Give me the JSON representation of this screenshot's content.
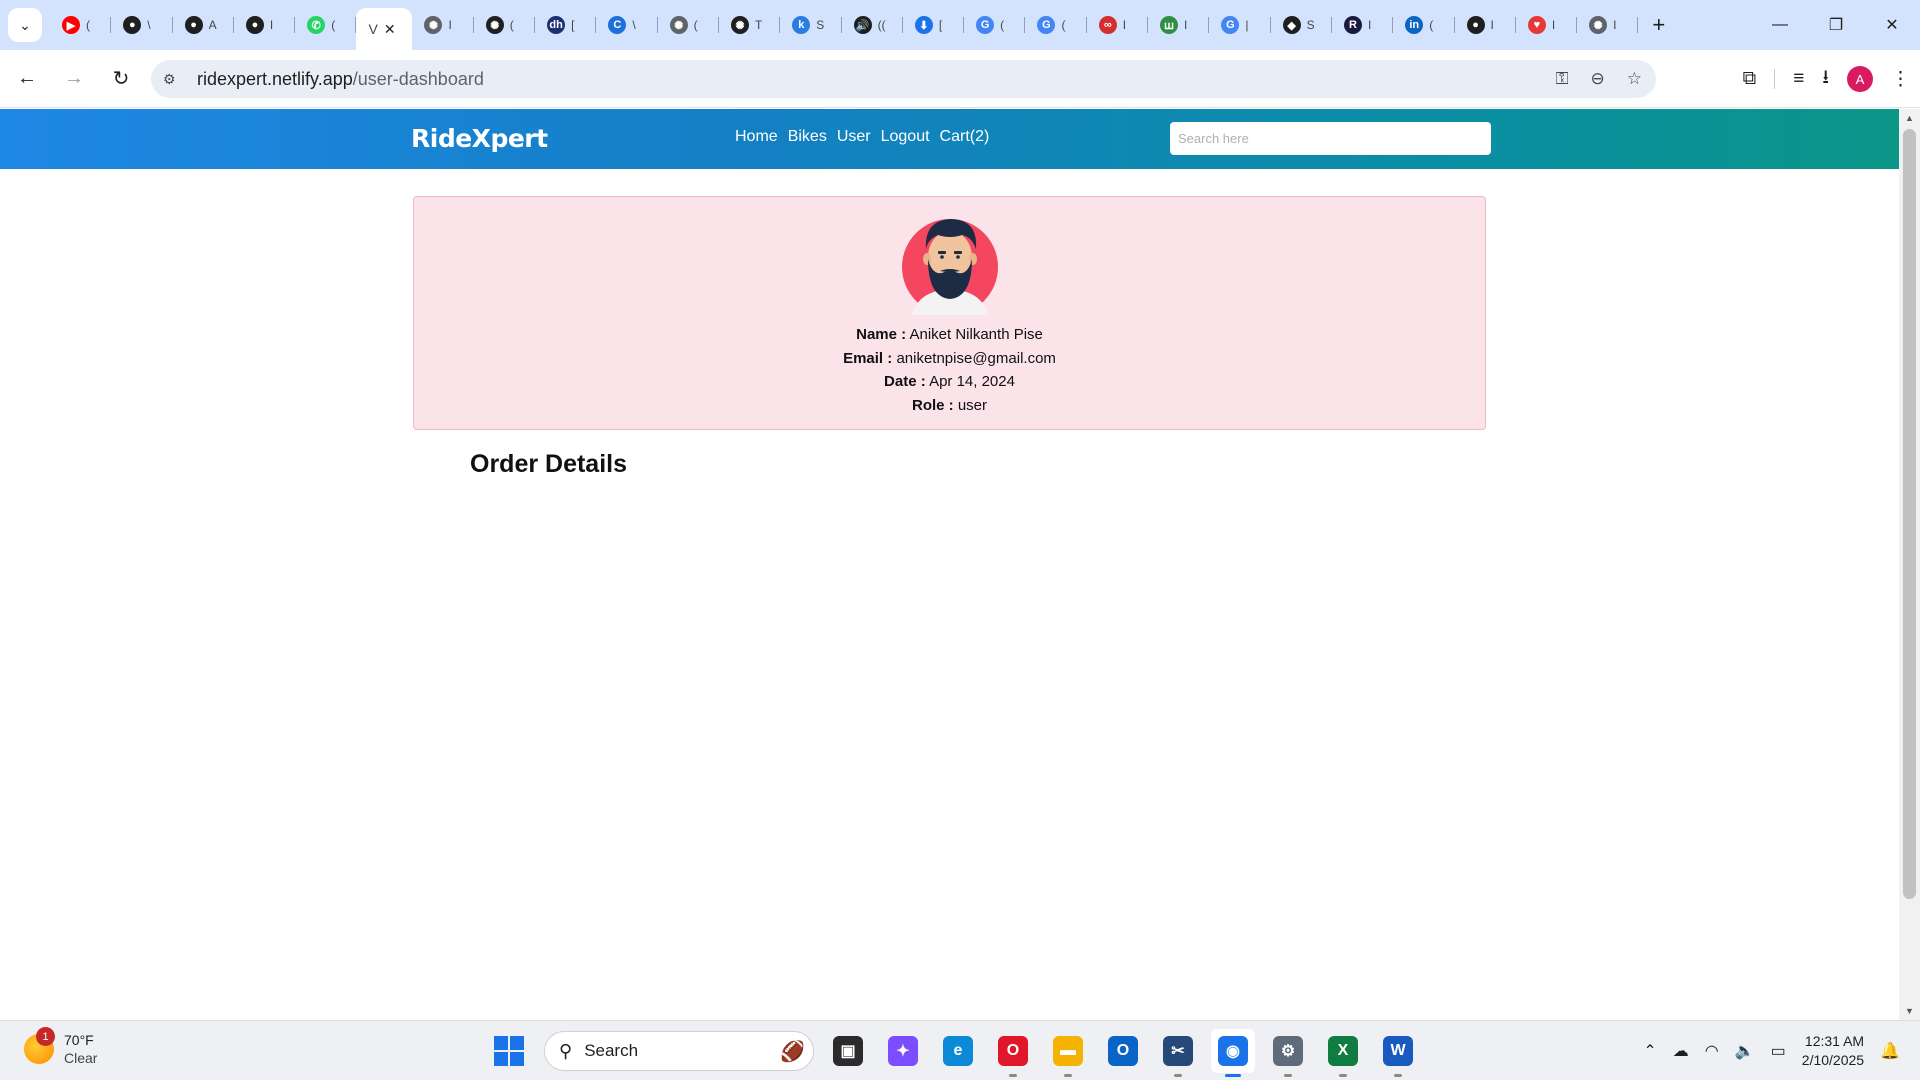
{
  "browser": {
    "tabs": [
      {
        "icon": "youtube-icon",
        "glyph": "▶",
        "color": "#ff0000",
        "title": "("
      },
      {
        "icon": "github-icon",
        "glyph": "●",
        "color": "#1f1f1f",
        "title": "\\"
      },
      {
        "icon": "github-icon",
        "glyph": "●",
        "color": "#1f1f1f",
        "title": "A"
      },
      {
        "icon": "github-icon",
        "glyph": "●",
        "color": "#1f1f1f",
        "title": "I"
      },
      {
        "icon": "whatsapp-icon",
        "glyph": "✆",
        "color": "#25d366",
        "title": "("
      },
      {
        "icon": "openai-icon",
        "glyph": "✺",
        "color": "#5f6368",
        "title": "I"
      },
      {
        "icon": "openai-icon",
        "glyph": "✺",
        "color": "#1f1f1f",
        "title": "("
      },
      {
        "icon": "dh-icon",
        "glyph": "dh",
        "color": "#1d2f6f",
        "title": "["
      },
      {
        "icon": "c-icon",
        "glyph": "C",
        "color": "#1e6fd9",
        "title": "\\"
      },
      {
        "icon": "openai-icon",
        "glyph": "✺",
        "color": "#5f6368",
        "title": "("
      },
      {
        "icon": "openai-icon",
        "glyph": "✺",
        "color": "#1f1f1f",
        "title": "T"
      },
      {
        "icon": "k-icon",
        "glyph": "k",
        "color": "#2a7de1",
        "title": "S"
      },
      {
        "icon": "audio-icon",
        "glyph": "🔊",
        "color": "#1f1f1f",
        "title": "(("
      },
      {
        "icon": "download-icon",
        "glyph": "⬇",
        "color": "#1a73e8",
        "title": "["
      },
      {
        "icon": "google-icon",
        "glyph": "G",
        "color": "#4285f4",
        "title": "("
      },
      {
        "icon": "google-icon",
        "glyph": "G",
        "color": "#4285f4",
        "title": "("
      },
      {
        "icon": "infinity-icon",
        "glyph": "∞",
        "color": "#d32f2f",
        "title": "I"
      },
      {
        "icon": "gfg-icon",
        "glyph": "ꟺ",
        "color": "#2f8d46",
        "title": "I"
      },
      {
        "icon": "google-icon",
        "glyph": "G",
        "color": "#4285f4",
        "title": "|"
      },
      {
        "icon": "shield-icon",
        "glyph": "◆",
        "color": "#1f1f1f",
        "title": "S"
      },
      {
        "icon": "r-icon",
        "glyph": "R",
        "color": "#1d1a3f",
        "title": "I"
      },
      {
        "icon": "linkedin-icon",
        "glyph": "in",
        "color": "#0a66c2",
        "title": "("
      },
      {
        "icon": "github-icon",
        "glyph": "●",
        "color": "#1f1f1f",
        "title": "I"
      },
      {
        "icon": "heart-icon",
        "glyph": "♥",
        "color": "#e53935",
        "title": "I"
      },
      {
        "icon": "openai-icon",
        "glyph": "✺",
        "color": "#5f6368",
        "title": "I"
      }
    ],
    "active_tab_title": "V",
    "url_host": "ridexpert.netlify.app",
    "url_path": "/user-dashboard",
    "profile_initial": "A"
  },
  "site": {
    "brand": "RideXpert",
    "nav": [
      "Home",
      "Bikes",
      "User",
      "Logout",
      "Cart(2)"
    ],
    "search_placeholder": "Search here"
  },
  "profile": {
    "name_label": "Name :",
    "name": "Aniket Nilkanth Pise",
    "email_label": "Email :",
    "email": "aniketnpise@gmail.com",
    "date_label": "Date :",
    "date": "Apr 14, 2024",
    "role_label": "Role :",
    "role": "user"
  },
  "orders": {
    "title": "Order Details"
  },
  "taskbar": {
    "temperature": "70°F",
    "condition": "Clear",
    "weather_badge": "1",
    "search_label": "Search",
    "time": "12:31 AM",
    "date": "2/10/2025",
    "apps": [
      {
        "name": "file-explorer-dark-icon",
        "glyph": "▣",
        "bg": "#2b2b2b",
        "running": false
      },
      {
        "name": "copilot-icon",
        "glyph": "✦",
        "bg": "#7c4dff",
        "running": false
      },
      {
        "name": "edge-icon",
        "glyph": "e",
        "bg": "#0c8ad8",
        "running": false
      },
      {
        "name": "opera-icon",
        "glyph": "O",
        "bg": "#e0162b",
        "running": true
      },
      {
        "name": "folder-icon",
        "glyph": "▬",
        "bg": "#f3b300",
        "running": true
      },
      {
        "name": "outlook-icon",
        "glyph": "O",
        "bg": "#0a64c8",
        "running": false
      },
      {
        "name": "snipping-tool-icon",
        "glyph": "✂",
        "bg": "#254a7a",
        "running": true
      },
      {
        "name": "chrome-icon",
        "glyph": "◉",
        "bg": "#1a73e8",
        "running": true,
        "active": true
      },
      {
        "name": "settings-icon",
        "glyph": "⚙",
        "bg": "#5f6b7a",
        "running": true
      },
      {
        "name": "excel-icon",
        "glyph": "X",
        "bg": "#107c41",
        "running": true
      },
      {
        "name": "word-icon",
        "glyph": "W",
        "bg": "#185abd",
        "running": true
      }
    ]
  }
}
